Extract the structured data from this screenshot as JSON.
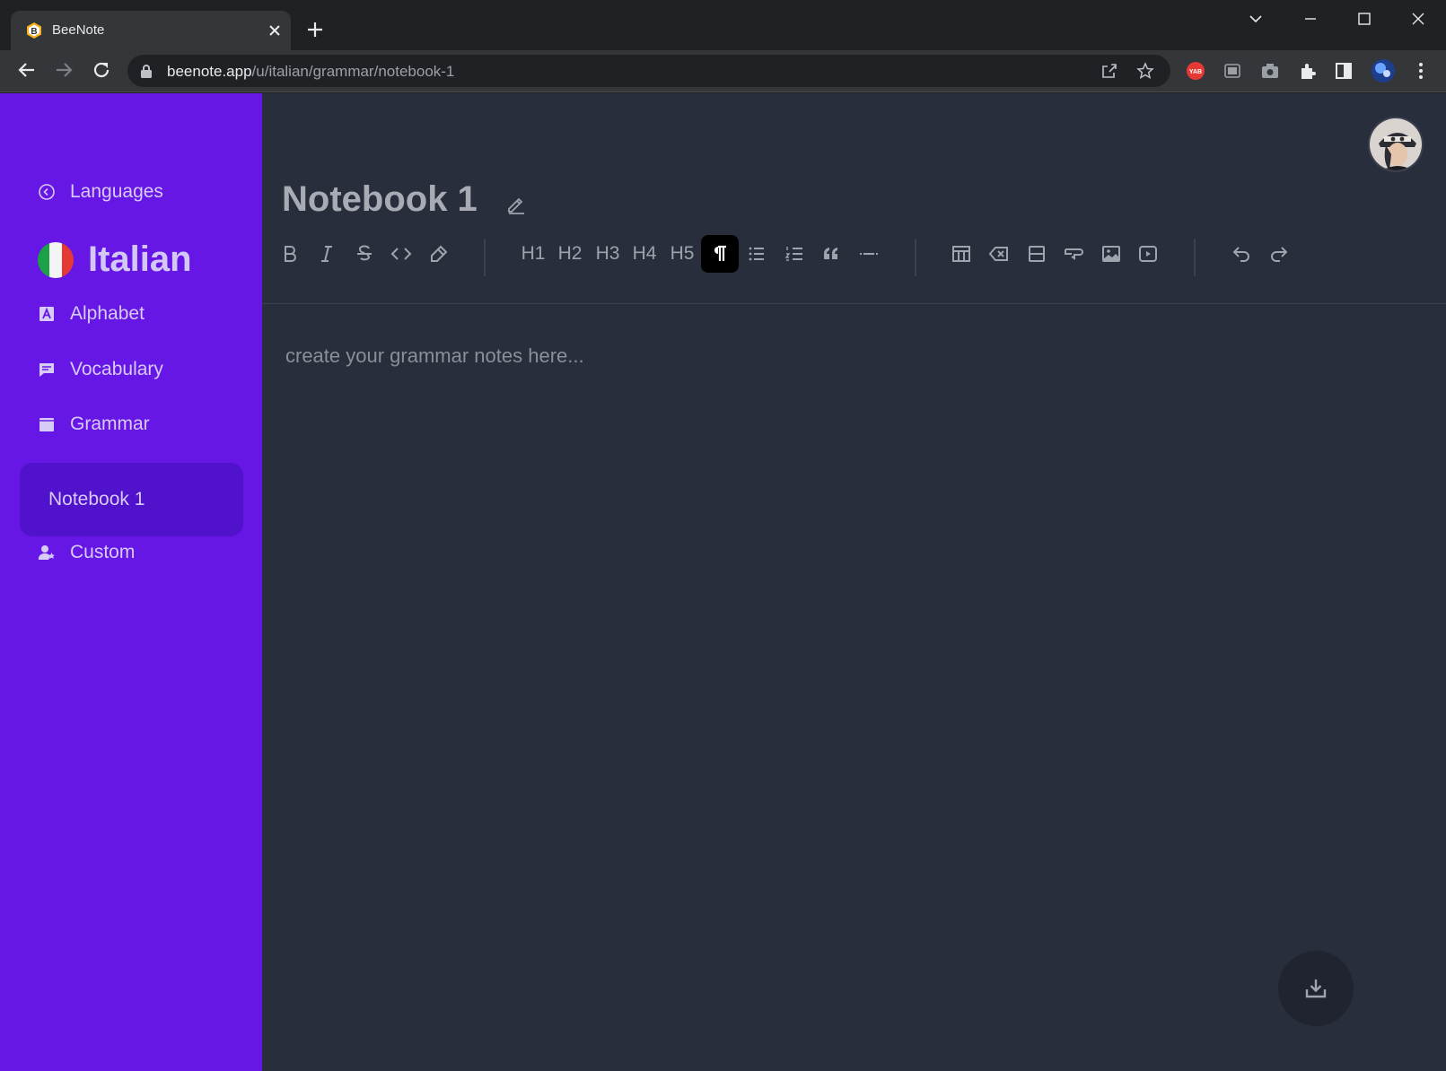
{
  "browser": {
    "tab_title": "BeeNote",
    "url_host": "beenote.app",
    "url_path": "/u/italian/grammar/notebook-1",
    "favicon_letter": "B"
  },
  "sidebar": {
    "back_link": "Languages",
    "language": "Italian",
    "items": [
      {
        "label": "Alphabet",
        "icon": "alphabet-icon"
      },
      {
        "label": "Vocabulary",
        "icon": "chat-icon"
      },
      {
        "label": "Grammar",
        "icon": "book-icon"
      },
      {
        "label": "Custom",
        "icon": "user-star-icon"
      }
    ],
    "active_sub_item": "Notebook 1"
  },
  "editor": {
    "title": "Notebook 1",
    "placeholder": "create your grammar notes here...",
    "headings": [
      "H1",
      "H2",
      "H3",
      "H4",
      "H5"
    ],
    "active_tool": "paragraph"
  },
  "colors": {
    "sidebar": "#6617e6",
    "sidebar_active": "#5112cc",
    "main_bg": "#282e3b"
  }
}
